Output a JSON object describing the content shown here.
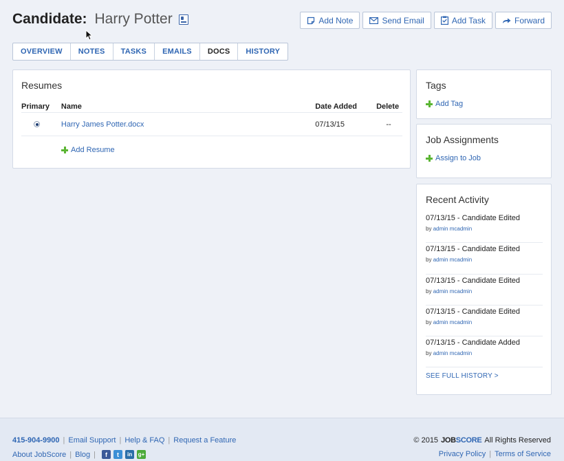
{
  "header": {
    "label": "Candidate:",
    "name": "Harry Potter",
    "actions": [
      {
        "label": "Add Note",
        "icon": "note-icon"
      },
      {
        "label": "Send Email",
        "icon": "envelope-icon"
      },
      {
        "label": "Add Task",
        "icon": "clipboard-check-icon"
      },
      {
        "label": "Forward",
        "icon": "forward-arrow-icon"
      }
    ]
  },
  "tabs": [
    {
      "label": "OVERVIEW"
    },
    {
      "label": "NOTES"
    },
    {
      "label": "TASKS"
    },
    {
      "label": "EMAILS"
    },
    {
      "label": "DOCS",
      "active": true
    },
    {
      "label": "HISTORY"
    }
  ],
  "resumes": {
    "title": "Resumes",
    "columns": [
      "Primary",
      "Name",
      "Date Added",
      "Delete"
    ],
    "rows": [
      {
        "name": "Harry James Potter.docx",
        "date": "07/13/15",
        "delete": "--"
      }
    ],
    "add_label": "Add Resume"
  },
  "tags": {
    "title": "Tags",
    "add_label": "Add Tag"
  },
  "jobs": {
    "title": "Job Assignments",
    "add_label": "Assign to Job"
  },
  "activity": {
    "title": "Recent Activity",
    "by_prefix": "by",
    "items": [
      {
        "text": "07/13/15 - Candidate Edited",
        "user": "admin mcadmin"
      },
      {
        "text": "07/13/15 - Candidate Edited",
        "user": "admin mcadmin"
      },
      {
        "text": "07/13/15 - Candidate Edited",
        "user": "admin mcadmin"
      },
      {
        "text": "07/13/15 - Candidate Edited",
        "user": "admin mcadmin"
      },
      {
        "text": "07/13/15 - Candidate Added",
        "user": "admin mcadmin"
      }
    ],
    "see_all": "SEE FULL HISTORY >"
  },
  "footer": {
    "phone": "415-904-9900",
    "links_row1": [
      "Email Support",
      "Help & FAQ",
      "Request a Feature"
    ],
    "links_row2": [
      "About JobScore",
      "Blog"
    ],
    "social": [
      {
        "icon": "facebook-icon",
        "glyph": "f",
        "color": "#3b5998"
      },
      {
        "icon": "twitter-icon",
        "glyph": "t",
        "color": "#3b8fd6"
      },
      {
        "icon": "linkedin-icon",
        "glyph": "in",
        "color": "#2b6ea8"
      },
      {
        "icon": "google-plus-icon",
        "glyph": "g+",
        "color": "#4caa3a"
      }
    ],
    "copyright": "© 2015",
    "brand_job": "JOB",
    "brand_score": "SCORE",
    "rights": "All Rights Reserved",
    "legal": [
      "Privacy Policy",
      "Terms of Service"
    ]
  }
}
